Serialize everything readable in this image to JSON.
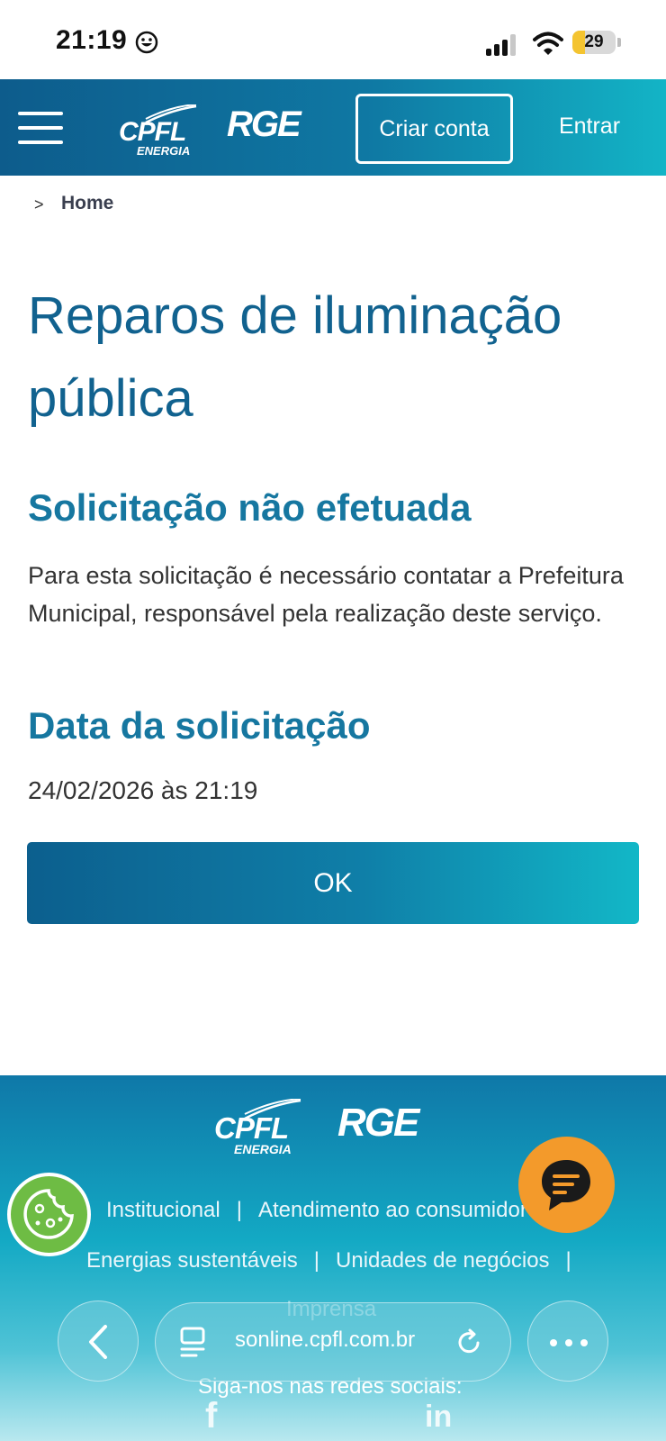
{
  "status_bar": {
    "time": "21:19",
    "battery_level": "29",
    "battery_fraction": 0.29,
    "icons": [
      "smiley-icon",
      "signal-icon",
      "wifi-icon",
      "battery-icon"
    ]
  },
  "header": {
    "logo_cpfl": "CPFL",
    "logo_cpfl_sub": "ENERGIA",
    "logo_rge": "RGE",
    "create_account_label": "Criar conta",
    "login_label": "Entrar"
  },
  "breadcrumb": {
    "separator": ">",
    "home": "Home"
  },
  "main": {
    "title": "Reparos de iluminação pública",
    "status_title": "Solicitação não efetuada",
    "message": "Para esta solicitação é necessário contatar a Prefeitura Municipal, responsável pela realização deste serviço.",
    "date_title": "Data da solicitação",
    "date_value": "24/02/2026 às 21:19",
    "ok_label": "OK"
  },
  "footer": {
    "logo_cpfl": "CPFL",
    "logo_cpfl_sub": "ENERGIA",
    "logo_rge": "RGE",
    "links_row1": [
      "Institucional",
      "Atendimento ao consumidor"
    ],
    "links_row2": [
      "Energias sustentáveis",
      "Unidades de negócios"
    ],
    "links_row3": "Imprensa",
    "social_label": "Siga-nos nas redes sociais:",
    "social_fb": "f",
    "social_in": "in"
  },
  "browser": {
    "url": "sonline.cpfl.com.br"
  },
  "colors": {
    "brand_dark": "#0d5c8c",
    "brand_light": "#13b4c6",
    "title_blue": "#11628f",
    "chat_orange": "#f39a2b",
    "cookie_green": "#6ebc44"
  }
}
